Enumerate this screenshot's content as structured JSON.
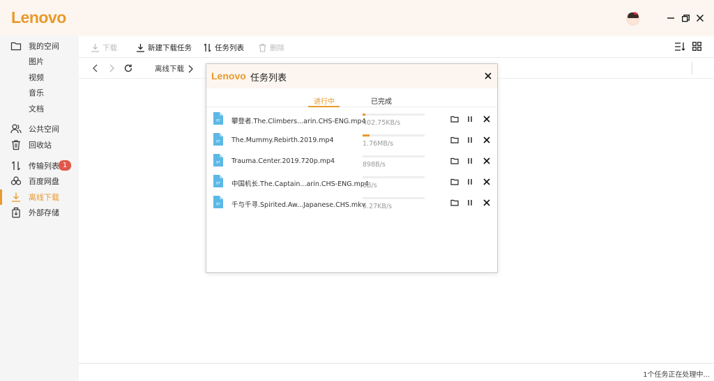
{
  "app": {
    "logo": "Lenovo"
  },
  "titlebar": {
    "avatar_icon": "user-avatar",
    "min_icon": "minimize-icon",
    "restore_icon": "restore-icon",
    "close_icon": "close-icon"
  },
  "sidebar": {
    "items": [
      {
        "label": "我的空间",
        "icon": "folder-icon",
        "level": 1
      },
      {
        "label": "图片",
        "level": 2
      },
      {
        "label": "视频",
        "level": 2
      },
      {
        "label": "音乐",
        "level": 2
      },
      {
        "label": "文档",
        "level": 2
      },
      {
        "label": "公共空间",
        "icon": "users-icon",
        "level": 1
      },
      {
        "label": "回收站",
        "icon": "trash-icon",
        "level": 1
      },
      {
        "label": "传输列表",
        "icon": "transfer-icon",
        "level": 1,
        "badge": "1"
      },
      {
        "label": "百度网盘",
        "icon": "cloud-link-icon",
        "level": 1
      },
      {
        "label": "离线下载",
        "icon": "download-icon",
        "level": 1,
        "active": true
      },
      {
        "label": "外部存储",
        "icon": "external-storage-icon",
        "level": 1
      }
    ]
  },
  "toolbar": {
    "download_label": "下载",
    "new_task_label": "新建下载任务",
    "task_list_label": "任务列表",
    "delete_label": "删除"
  },
  "navbar": {
    "breadcrumb": "离线下载"
  },
  "dialog": {
    "logo": "Lenovo",
    "title": "任务列表",
    "tabs": [
      {
        "label": "进行中",
        "active": true
      },
      {
        "label": "已完成",
        "active": false
      }
    ],
    "tasks": [
      {
        "name": "攀登者.The.Climbers...arin.CHS-ENG.mp4",
        "speed": "402.75KB/s",
        "progress": 0.04
      },
      {
        "name": "The.Mummy.Rebirth.2019.mp4",
        "speed": "1.76MB/s",
        "progress": 0.11
      },
      {
        "name": "Trauma.Center.2019.720p.mp4",
        "speed": "898B/s",
        "progress": 0.0
      },
      {
        "name": "中国机长.The.Captain...arin.CHS-ENG.mp4",
        "speed": "0B/s",
        "progress": 0.0
      },
      {
        "name": "千与千寻.Spirited.Aw...Japanese.CHS.mkv",
        "speed": "5.27KB/s",
        "progress": 0.0
      }
    ]
  },
  "status": {
    "text": "1个任务正在处理中..."
  },
  "colors": {
    "accent": "#e89a2c",
    "badge": "#e0584a",
    "file_icon": "#5cb8e6"
  }
}
